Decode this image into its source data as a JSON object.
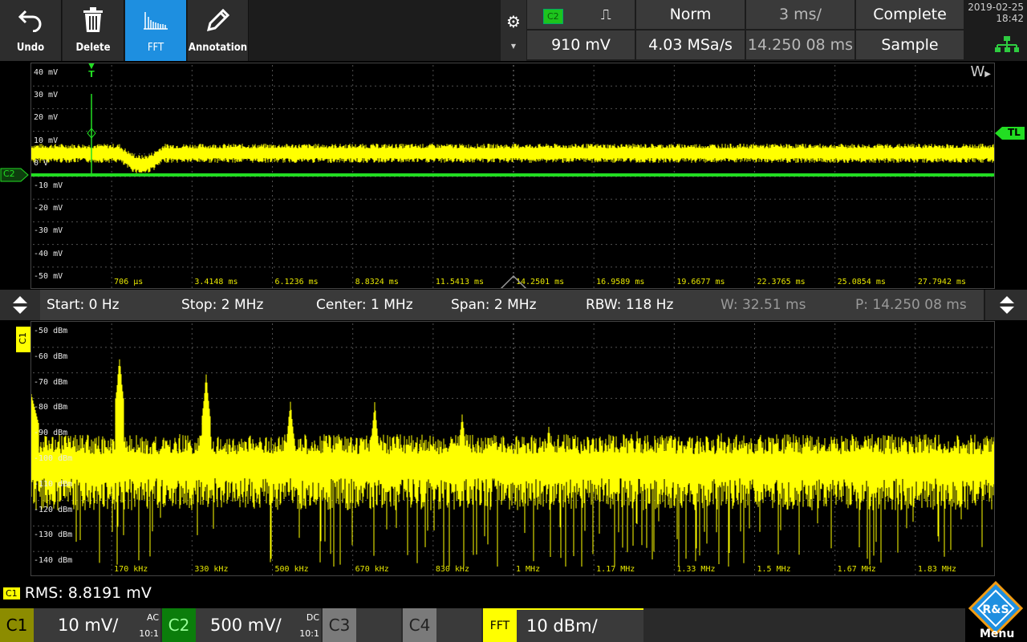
{
  "toolbar": {
    "undo_label": "Undo",
    "delete_label": "Delete",
    "fft_label": "FFT",
    "annotation_label": "Annotation"
  },
  "trigger": {
    "source": "C2",
    "slope_symbol": "⎍",
    "mode": "Norm",
    "timebase": "3 ms/",
    "status": "Complete",
    "level": "910 mV",
    "sample_rate": "4.03 MSa/s",
    "position": "14.250 08 ms",
    "acq_mode": "Sample"
  },
  "datetime": {
    "date": "2019-02-25",
    "time": "18:42"
  },
  "time_pane": {
    "y_labels": [
      "40 mV",
      "30 mV",
      "20 mV",
      "10 mV",
      "0 V",
      "-10 mV",
      "-20 mV",
      "-30 mV",
      "-40 mV",
      "-50 mV"
    ],
    "x_labels": [
      "706 µs",
      "3.4148 ms",
      "6.1236 ms",
      "8.8324 ms",
      "11.5413 ms",
      "14.2501 ms",
      "16.9589 ms",
      "19.6677 ms",
      "22.3765 ms",
      "25.0854 ms",
      "27.7942 ms"
    ],
    "ch_marker": "C2",
    "tl_marker": "TL",
    "window_marker": "W",
    "trigger_marker": "T"
  },
  "fft_bar": {
    "start": "Start: 0 Hz",
    "stop": "Stop: 2 MHz",
    "center": "Center: 1 MHz",
    "span": "Span: 2 MHz",
    "rbw": "RBW: 118 Hz",
    "window": "W: 32.51 ms",
    "position": "P: 14.250 08 ms"
  },
  "fft_pane": {
    "y_labels": [
      "-50 dBm",
      "-60 dBm",
      "-70 dBm",
      "-80 dBm",
      "-90 dBm",
      "-100 dBm",
      "-110 dBm",
      "-120 dBm",
      "-130 dBm",
      "-140 dBm"
    ],
    "x_labels": [
      "170 kHz",
      "330 kHz",
      "500 kHz",
      "670 kHz",
      "830 kHz",
      "1 MHz",
      "1.17 MHz",
      "1.33 MHz",
      "1.5 MHz",
      "1.67 MHz",
      "1.83 MHz"
    ],
    "ch_marker": "C1"
  },
  "measurement": {
    "badge": "C1",
    "text": "RMS: 8.8191 mV"
  },
  "channels": [
    {
      "name": "C1",
      "scale": "10 mV/",
      "coupling": "AC",
      "probe": "10:1"
    },
    {
      "name": "C2",
      "scale": "500 mV/",
      "coupling": "DC",
      "probe": "10:1"
    },
    {
      "name": "C3"
    },
    {
      "name": "C4"
    },
    {
      "name": "FFT",
      "scale": "10 dBm/"
    }
  ],
  "menu_label": "Menu",
  "colors": {
    "ch1": "#ffff00",
    "ch2": "#22dd22",
    "active": "#1e8fe0"
  }
}
